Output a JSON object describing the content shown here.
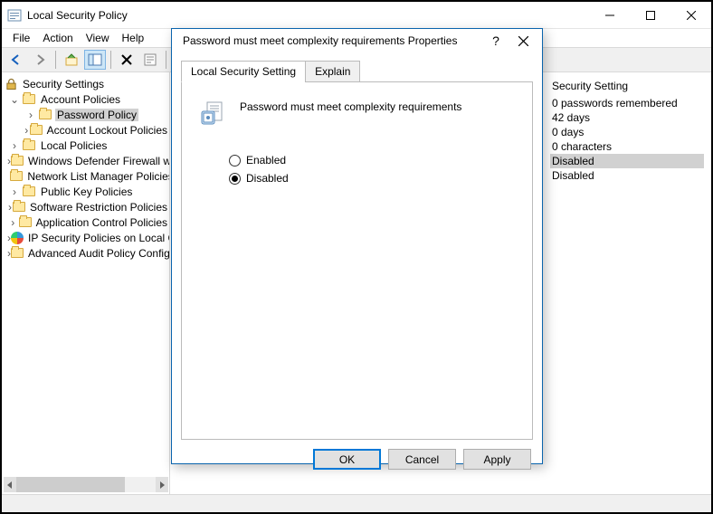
{
  "window": {
    "title": "Local Security Policy",
    "menus": [
      "File",
      "Action",
      "View",
      "Help"
    ]
  },
  "tree": {
    "root": "Security Settings",
    "items": [
      {
        "label": "Account Policies",
        "expanded": true,
        "level": 1,
        "children": [
          {
            "label": "Password Policy",
            "level": 2,
            "selected": true
          },
          {
            "label": "Account Lockout Policies",
            "level": 2
          }
        ]
      },
      {
        "label": "Local Policies",
        "level": 1
      },
      {
        "label": "Windows Defender Firewall with Advanced Security",
        "level": 1
      },
      {
        "label": "Network List Manager Policies",
        "level": 1
      },
      {
        "label": "Public Key Policies",
        "level": 1
      },
      {
        "label": "Software Restriction Policies",
        "level": 1
      },
      {
        "label": "Application Control Policies",
        "level": 1
      },
      {
        "label": "IP Security Policies on Local Computer",
        "level": 1,
        "icon": "shield"
      },
      {
        "label": "Advanced Audit Policy Configuration",
        "level": 1
      }
    ]
  },
  "detail": {
    "header": "Security Setting",
    "values": [
      "0 passwords remembered",
      "42 days",
      "0 days",
      "0 characters",
      "Disabled",
      "Disabled"
    ],
    "selected_index": 4
  },
  "dialog": {
    "title": "Password must meet complexity requirements Properties",
    "tabs": [
      "Local Security Setting",
      "Explain"
    ],
    "active_tab": 0,
    "policy_name": "Password must meet complexity requirements",
    "options": {
      "enabled": "Enabled",
      "disabled": "Disabled"
    },
    "selected": "disabled",
    "buttons": {
      "ok": "OK",
      "cancel": "Cancel",
      "apply": "Apply"
    }
  }
}
